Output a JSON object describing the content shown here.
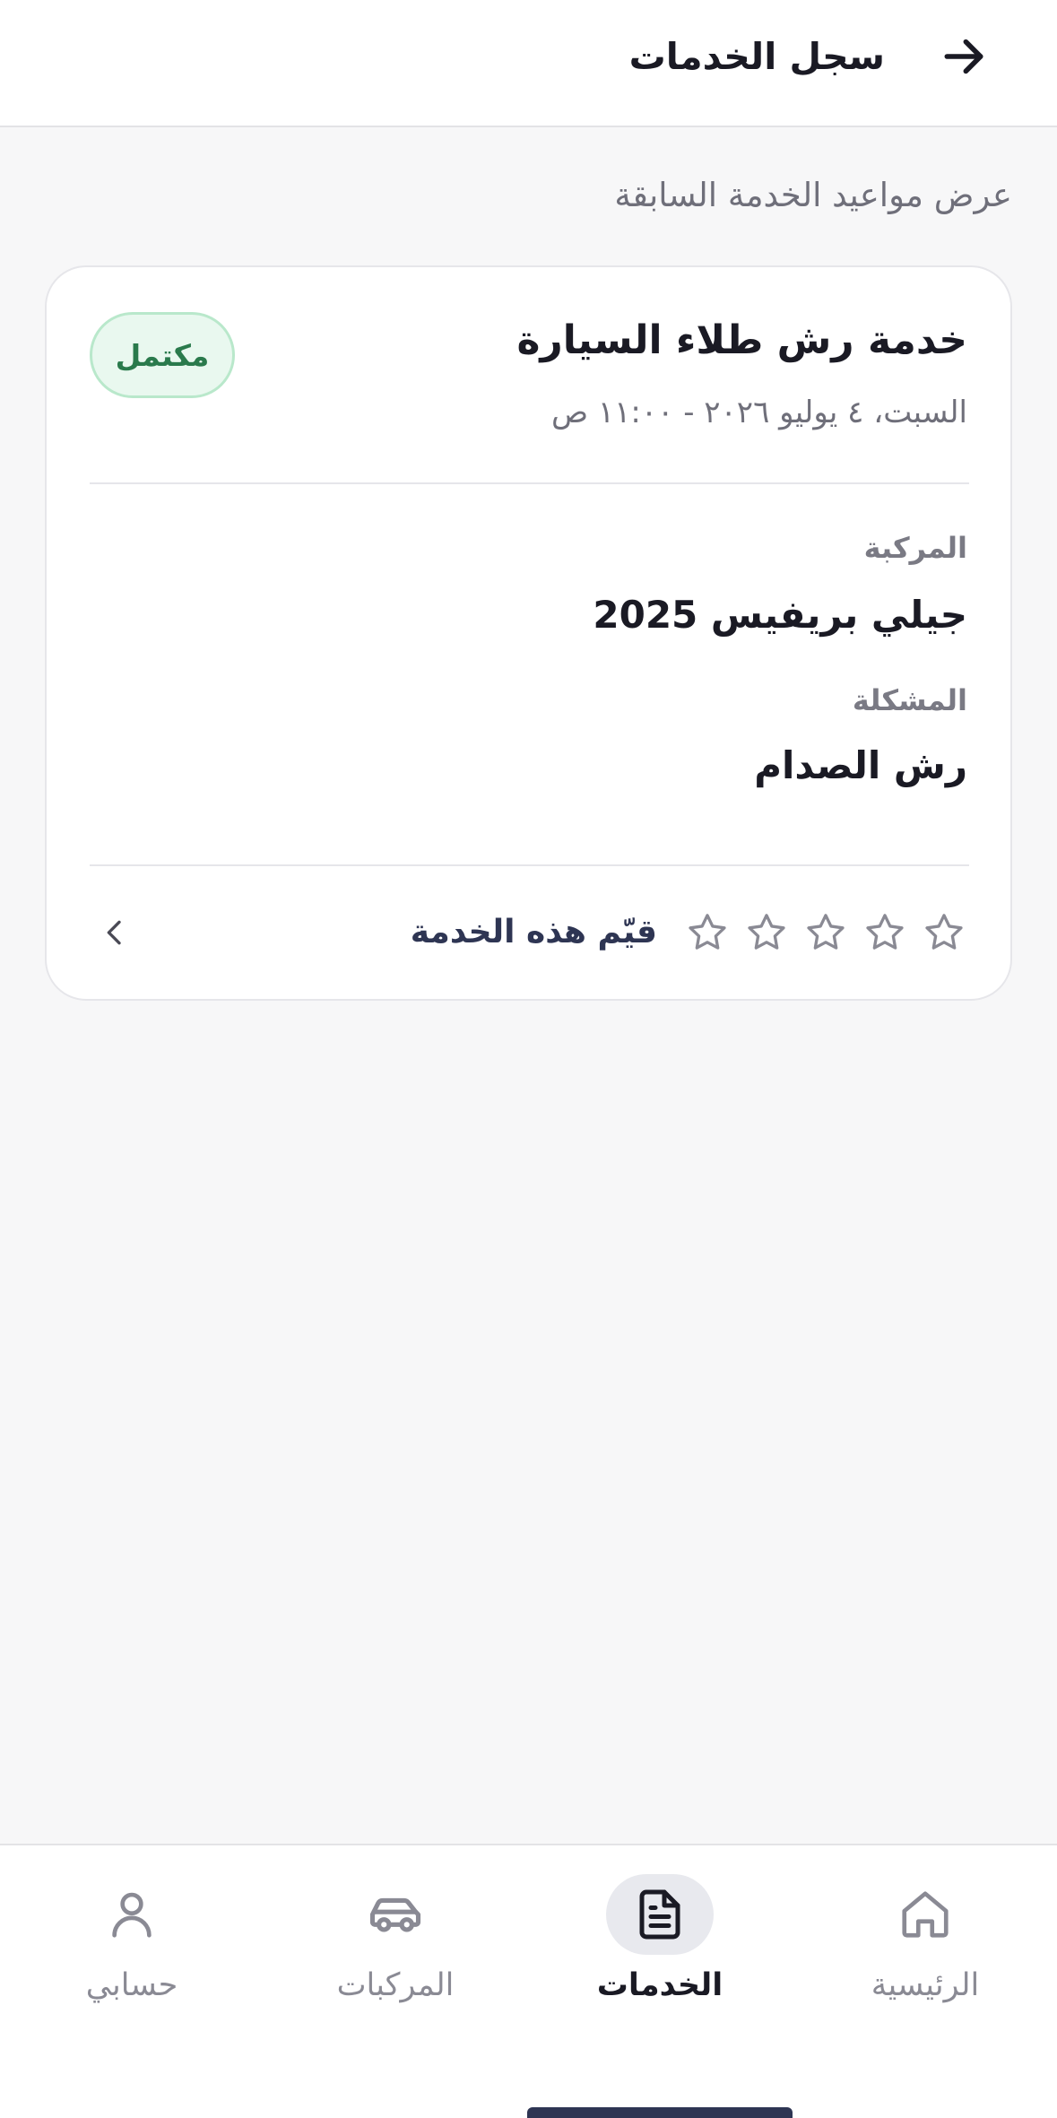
{
  "header": {
    "title": "سجل الخدمات",
    "back_icon": "arrow-right-icon"
  },
  "subtitle": "عرض مواعيد الخدمة السابقة",
  "service_card": {
    "title": "خدمة رش طلاء السيارة",
    "date": "السبت، ٤ يوليو ٢٠٢٦ - ١١:٠٠ ص",
    "status": "مكتمل",
    "vehicle_label": "المركبة",
    "vehicle_value": "جيلي بريفيس 2025",
    "issue_label": "المشكلة",
    "issue_value": "رش الصدام",
    "rating": {
      "prompt": "قيّم هذه الخدمة",
      "value": 0,
      "max": 5
    }
  },
  "bottom_nav": {
    "items": [
      {
        "label": "الرئيسية",
        "icon": "home-icon",
        "active": false
      },
      {
        "label": "الخدمات",
        "icon": "document-icon",
        "active": true
      },
      {
        "label": "المركبات",
        "icon": "car-icon",
        "active": false
      },
      {
        "label": "حسابي",
        "icon": "user-icon",
        "active": false
      }
    ]
  },
  "colors": {
    "status_bg": "#e9f8ef",
    "status_text": "#2a7a4c",
    "accent_dark": "#2e3553",
    "background": "#f7f7f8"
  }
}
